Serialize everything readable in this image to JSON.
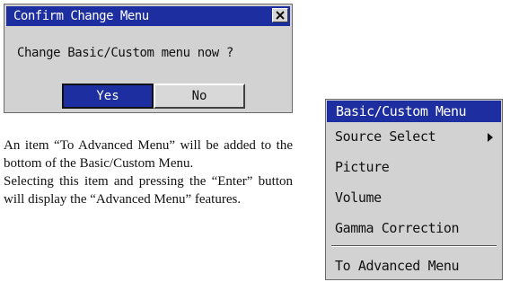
{
  "dialog": {
    "title": "Confirm Change Menu",
    "close_glyph": "✕",
    "message": "Change Basic/Custom menu now ?",
    "yes_label": "Yes",
    "no_label": "No"
  },
  "text": {
    "paragraph1": "An item “To Advanced Menu” will be added to the bottom of the Basic/Custom Menu.",
    "paragraph2": "Selecting this item and pressing the “Enter” button will display the “Advanced Menu” features."
  },
  "menu": {
    "title": "Basic/Custom Menu",
    "items": [
      {
        "label": "Source Select",
        "icon": "submenu-arrow-icon"
      },
      {
        "label": "Picture"
      },
      {
        "label": "Volume"
      },
      {
        "label": "Gamma Correction"
      },
      {
        "label": "To Advanced Menu"
      }
    ]
  },
  "colors": {
    "title_bar": "#1d2ea0",
    "panel": "#d2d2d2",
    "selected_button": "#1d2ea0"
  }
}
